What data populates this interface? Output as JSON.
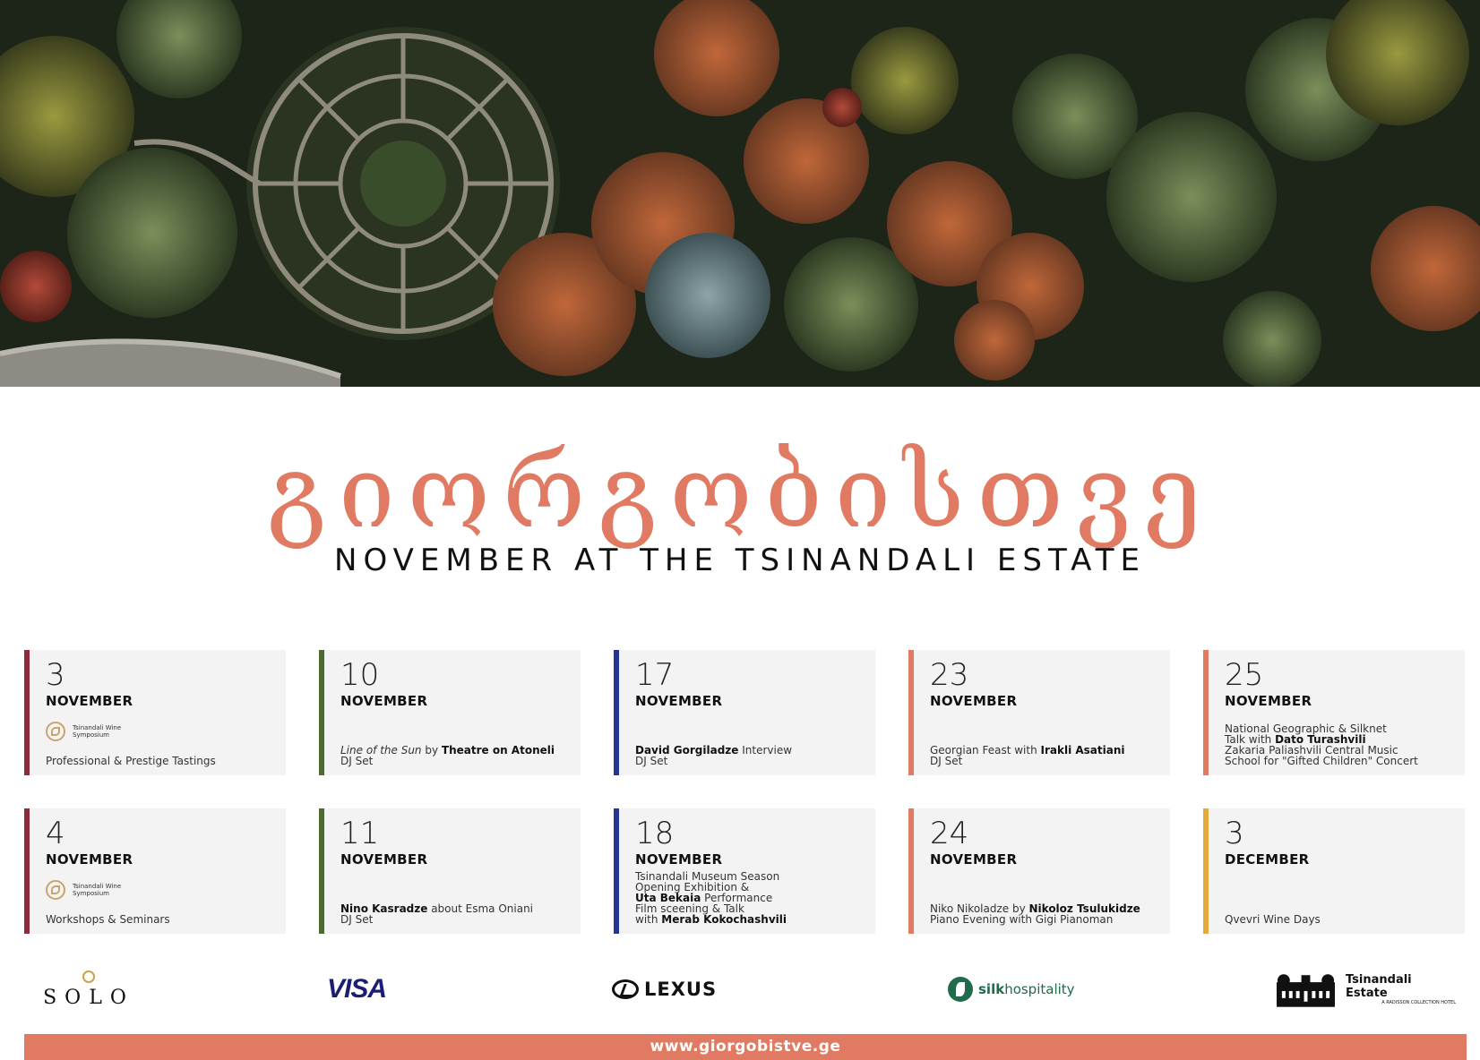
{
  "header": {
    "title_georgian": "გიორგობისთვე",
    "title_english": "NOVEMBER AT THE TSINANDALI ESTATE"
  },
  "symposium_logo_text": "Tsinandali Wine Symposium",
  "colors": {
    "accent": "#e07a63",
    "maroon": "#8b2c3c",
    "olive": "#4d6b2e",
    "navy": "#26358f",
    "salmon": "#e07a63",
    "gold": "#e3a93b"
  },
  "events": [
    {
      "day": "3",
      "month": "NOVEMBER",
      "accent": "#8b2c3c",
      "has_logo": true,
      "lines": [
        [
          {
            "t": "Professional & Prestige Tastings"
          }
        ]
      ]
    },
    {
      "day": "10",
      "month": "NOVEMBER",
      "accent": "#4d6b2e",
      "has_logo": false,
      "lines": [
        [
          {
            "t": "Line of the Sun",
            "s": "i"
          },
          {
            "t": " by "
          },
          {
            "t": "Theatre on Atoneli",
            "s": "b"
          }
        ],
        [
          {
            "t": "DJ Set"
          }
        ]
      ]
    },
    {
      "day": "17",
      "month": "NOVEMBER",
      "accent": "#26358f",
      "has_logo": false,
      "lines": [
        [
          {
            "t": "David Gorgiladze",
            "s": "b"
          },
          {
            "t": " Interview"
          }
        ],
        [
          {
            "t": "DJ Set"
          }
        ]
      ]
    },
    {
      "day": "23",
      "month": "NOVEMBER",
      "accent": "#e07a63",
      "has_logo": false,
      "lines": [
        [
          {
            "t": "Georgian Feast with "
          },
          {
            "t": "Irakli Asatiani",
            "s": "b"
          }
        ],
        [
          {
            "t": "DJ Set"
          }
        ]
      ]
    },
    {
      "day": "25",
      "month": "NOVEMBER",
      "accent": "#e07a63",
      "has_logo": false,
      "lines": [
        [
          {
            "t": "National Geographic & Silknet"
          }
        ],
        [
          {
            "t": "Talk with "
          },
          {
            "t": "Dato Turashvili",
            "s": "b"
          }
        ],
        [
          {
            "t": "Zakaria Paliashvili Central Music"
          }
        ],
        [
          {
            "t": "School for \"Gifted Children\" Concert"
          }
        ]
      ]
    },
    {
      "day": "4",
      "month": "NOVEMBER",
      "accent": "#8b2c3c",
      "has_logo": true,
      "lines": [
        [
          {
            "t": "Workshops & Seminars"
          }
        ]
      ]
    },
    {
      "day": "11",
      "month": "NOVEMBER",
      "accent": "#4d6b2e",
      "has_logo": false,
      "lines": [
        [
          {
            "t": "Nino Kasradze",
            "s": "b"
          },
          {
            "t": " about Esma Oniani"
          }
        ],
        [
          {
            "t": "DJ Set"
          }
        ]
      ]
    },
    {
      "day": "18",
      "month": "NOVEMBER",
      "accent": "#26358f",
      "has_logo": false,
      "lines": [
        [
          {
            "t": "Tsinandali Museum Season"
          }
        ],
        [
          {
            "t": "Opening Exhibition &"
          }
        ],
        [
          {
            "t": "Uta Bekaia",
            "s": "b"
          },
          {
            "t": " Performance"
          }
        ],
        [
          {
            "t": "Film sceening & Talk"
          }
        ],
        [
          {
            "t": "with "
          },
          {
            "t": "Merab Kokochashvili",
            "s": "b"
          }
        ]
      ]
    },
    {
      "day": "24",
      "month": "NOVEMBER",
      "accent": "#e07a63",
      "has_logo": false,
      "lines": [
        [
          {
            "t": "Niko Nikoladze by "
          },
          {
            "t": "Nikoloz Tsulukidze",
            "s": "b"
          }
        ],
        [
          {
            "t": "Piano Evening with Gigi Pianoman"
          }
        ]
      ]
    },
    {
      "day": "3",
      "month": "DECEMBER",
      "accent": "#e3a93b",
      "has_logo": false,
      "lines": [
        [
          {
            "t": "Qvevri Wine Days"
          }
        ]
      ]
    }
  ],
  "sponsors": {
    "solo": "SOLO",
    "visa": "VISA",
    "lexus": "LEXUS",
    "silk_prefix": "silk",
    "silk_suffix": "hospitality",
    "estate_name": "Tsinandali Estate",
    "estate_sub": "A RADISSON COLLECTION HOTEL"
  },
  "footer": {
    "url": "www.giorgobistve.ge"
  }
}
